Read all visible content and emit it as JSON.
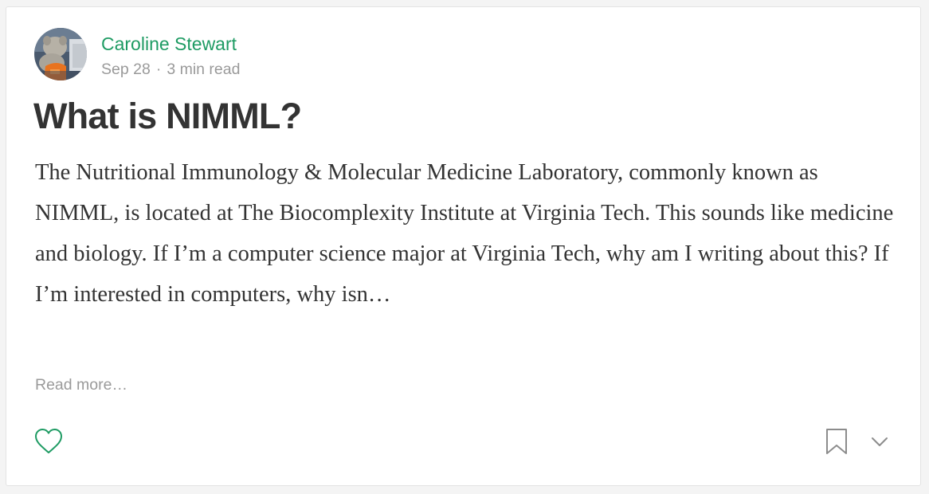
{
  "post": {
    "author": {
      "name": "Caroline Stewart",
      "avatar_icon": "author-avatar-photo"
    },
    "meta": {
      "date": "Sep 28",
      "separator": "·",
      "read_time": "3 min read"
    },
    "title": "What is NIMML?",
    "excerpt": "The Nutritional Immunology & Molecular Medicine Laboratory, commonly known as NIMML, is located at The Biocomplexity Institute at Virginia Tech. This sounds like medicine and biology. If I’m a computer science major at Virginia Tech, why am I writing about this? If I’m interested in computers, why isn…",
    "read_more_label": "Read more…"
  },
  "actions": {
    "clap_icon": "heart-icon",
    "bookmark_icon": "bookmark-icon",
    "more_icon": "chevron-down-icon"
  },
  "colors": {
    "accent": "#1e9b63",
    "text": "#333333",
    "muted": "#9a9a9a",
    "icon": "#8c8c8c"
  }
}
